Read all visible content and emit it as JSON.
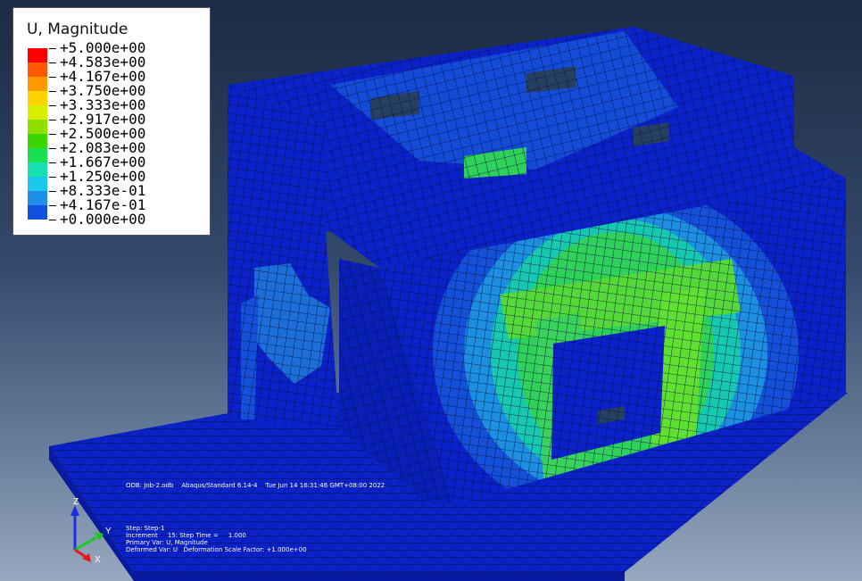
{
  "legend": {
    "title": "U, Magnitude",
    "entries": [
      {
        "label": "+5.000e+00",
        "color": "#ff0000"
      },
      {
        "label": "+4.583e+00",
        "color": "#ff5a00"
      },
      {
        "label": "+4.167e+00",
        "color": "#ff9900"
      },
      {
        "label": "+3.750e+00",
        "color": "#ffd200"
      },
      {
        "label": "+3.333e+00",
        "color": "#d6f000"
      },
      {
        "label": "+2.917e+00",
        "color": "#8ee000"
      },
      {
        "label": "+2.500e+00",
        "color": "#3ad600"
      },
      {
        "label": "+2.083e+00",
        "color": "#1adf50"
      },
      {
        "label": "+1.667e+00",
        "color": "#17e0b0"
      },
      {
        "label": "+1.250e+00",
        "color": "#1ac8ee"
      },
      {
        "label": "+8.333e-01",
        "color": "#1c8fe8"
      },
      {
        "label": "+4.167e-01",
        "color": "#1250e2"
      },
      {
        "label": "+0.000e+00",
        "color": "#0a12d8"
      }
    ]
  },
  "status": {
    "odb_line": "ODB: Job-2.odb    Abaqus/Standard 6.14-4    Tue Jun 14 16:31:46 GMT+08:00 2022",
    "step": "Step: Step-1",
    "increment": "Increment     15: Step Time =     1.000",
    "primary_var": "Primary Var: U, Magnitude",
    "deformed_var": "Deformed Var: U   Deformation Scale Factor: +1.000e+00"
  },
  "triad": {
    "z": "Z",
    "y": "Y",
    "x": "X"
  },
  "colors": {
    "mesh_dark_blue": "#0a1fc4",
    "mesh_mid_blue": "#1550d8",
    "mesh_light_blue": "#1c8fe0",
    "mesh_green": "#2fd15a",
    "background_top": "#1c2b44",
    "background_bottom": "#98a8bf"
  }
}
